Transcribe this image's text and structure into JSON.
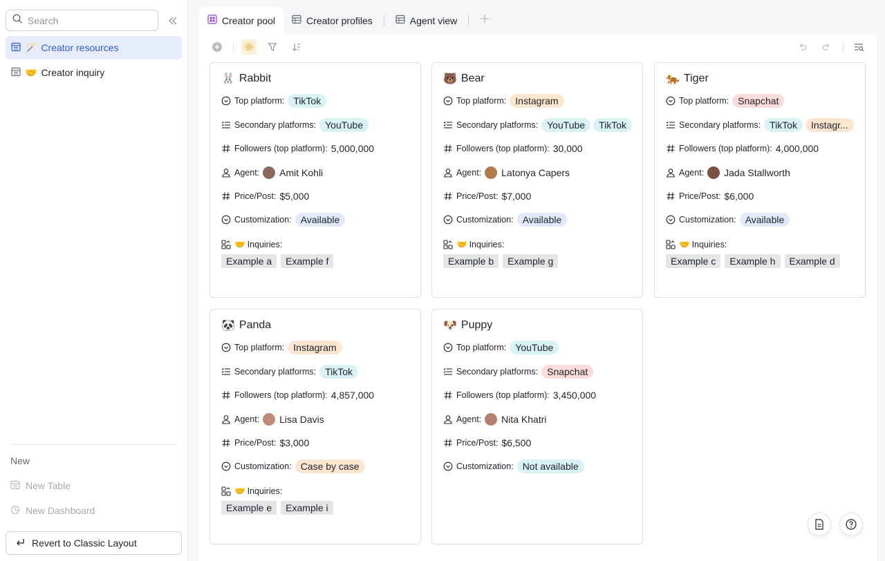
{
  "sidebar": {
    "search_placeholder": "Search",
    "items": [
      {
        "emoji": "🪄",
        "label": "Creator resources",
        "active": true
      },
      {
        "emoji": "🤝",
        "label": "Creator inquiry",
        "active": false
      }
    ],
    "new_section_label": "New",
    "new_table_label": "New Table",
    "new_dashboard_label": "New Dashboard",
    "revert_label": "Revert to Classic Layout"
  },
  "tabs": [
    {
      "label": "Creator pool",
      "active": true
    },
    {
      "label": "Creator profiles",
      "active": false
    },
    {
      "label": "Agent view",
      "active": false
    }
  ],
  "field_labels": {
    "top_platform": "Top platform:",
    "secondary_platforms": "Secondary platforms:",
    "followers": "Followers (top platform):",
    "agent": "Agent:",
    "price": "Price/Post:",
    "customization": "Customization:",
    "inquiries_emoji": "🤝",
    "inquiries": "Inquiries:"
  },
  "cards": [
    {
      "emoji": "🐰",
      "name": "Rabbit",
      "top_platform": "TikTok",
      "secondary_platforms": [
        "YouTube"
      ],
      "followers": "5,000,000",
      "agent": "Amit Kohli",
      "price": "$5,000",
      "customization": "Available",
      "inquiries": [
        "Example a",
        "Example f"
      ]
    },
    {
      "emoji": "🐻",
      "name": "Bear",
      "top_platform": "Instagram",
      "secondary_platforms": [
        "YouTube",
        "TikTok"
      ],
      "followers": "30,000",
      "agent": "Latonya Capers",
      "price": "$7,000",
      "customization": "Available",
      "inquiries": [
        "Example b",
        "Example g"
      ]
    },
    {
      "emoji": "🐅",
      "name": "Tiger",
      "top_platform": "Snapchat",
      "secondary_platforms": [
        "TikTok",
        "Instagr..."
      ],
      "followers": "4,000,000",
      "agent": "Jada Stallworth",
      "price": "$6,000",
      "customization": "Available",
      "inquiries": [
        "Example c",
        "Example h",
        "Example d"
      ]
    },
    {
      "emoji": "🐼",
      "name": "Panda",
      "top_platform": "Instagram",
      "secondary_platforms": [
        "TikTok"
      ],
      "followers": "4,857,000",
      "agent": "Lisa Davis",
      "price": "$3,000",
      "customization": "Case by case",
      "inquiries": [
        "Example e",
        "Example i"
      ]
    },
    {
      "emoji": "🐶",
      "name": "Puppy",
      "top_platform": "YouTube",
      "secondary_platforms": [
        "Snapchat"
      ],
      "followers": "3,450,000",
      "agent": "Nita Khatri",
      "price": "$6,500",
      "customization": "Not available",
      "inquiries": []
    }
  ],
  "colors": {
    "accent": "#2f5bd3",
    "tag_blue": "#d9f2f6",
    "tag_orange": "#fde6cf",
    "tag_red": "#fcdcdb",
    "tag_available": "#e1e9fb",
    "tag_gray": "#e4e5e7"
  },
  "icons": {
    "single_select": "chevron-circle-icon",
    "multi_select": "checklist-icon",
    "number": "hash-icon",
    "person": "person-icon",
    "link": "link-record-icon"
  }
}
